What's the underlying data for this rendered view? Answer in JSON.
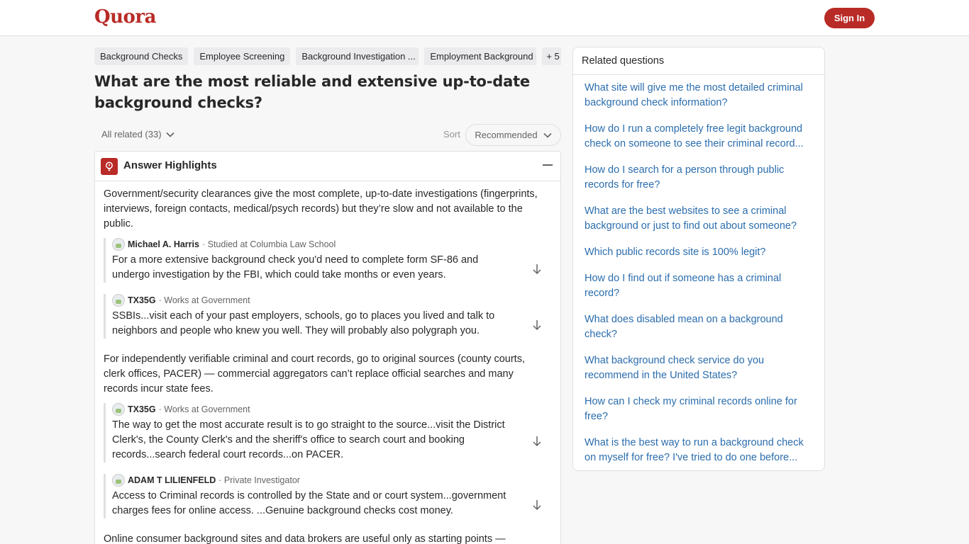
{
  "header": {
    "logo": "Quora",
    "signin_label": "Sign In"
  },
  "topics": [
    "Background Checks",
    "Employee Screening",
    "Background Investigation ...",
    "Employment Background C",
    "+ 5"
  ],
  "question": {
    "title": "What are the most reliable and extensive up-to-date background checks?"
  },
  "filters": {
    "all_related": "All related (33)",
    "sort_label": "Sort",
    "sort_value": "Recommended"
  },
  "highlights": {
    "title": "Answer Highlights",
    "summary1": "Government/security clearances give the most complete, up-to-date investigations (fingerprints, interviews, foreign contacts, medical/psych records) but they’re slow and not available to the public.",
    "quotes1": [
      {
        "author": "Michael A. Harris",
        "credential": "· Studied at Columbia Law School",
        "text": "For a more extensive background check you'd need to complete form SF-86 and undergo investigation by the FBI, which could take months or even years."
      },
      {
        "author": "TX35G",
        "credential": "· Works at Government",
        "text": "SSBIs...visit each of your past employers, schools, go to places you lived and talk to neighbors and people who knew you well. They will probably also polygraph you."
      }
    ],
    "summary2": "For independently verifiable criminal and court records, go to original sources (county courts, clerk offices, PACER) — commercial aggregators can’t replace official searches and many records incur state fees.",
    "quotes2": [
      {
        "author": "TX35G",
        "credential": "· Works at Government",
        "text": "The way to get the most accurate result is to go straight to the source...visit the District Clerk's, the County Clerk's and the sheriff's office to search court and booking records...search federal court records...on PACER."
      },
      {
        "author": "ADAM T LILIENFELD",
        "credential": "· Private Investigator",
        "text": "Access to Criminal records is controlled by the State and or court system...government charges fees for online access. ...Genuine background checks cost money."
      }
    ],
    "summary3": "Online consumer background sites and data brokers are useful only as starting points —"
  },
  "sidebar": {
    "title": "Related questions",
    "questions": [
      "What site will give me the most detailed criminal background check information?",
      "How do I run a completely free legit background check on someone to see their criminal record...",
      "How do I search for a person through public records for free?",
      "What are the best websites to see a criminal background or just to find out about someone?",
      "Which public records site is 100% legit?",
      "How do I find out if someone has a criminal record?",
      "What does disabled mean on a background check?",
      "What background check service do you recommend in the United States?",
      "How can I check my criminal records online for free?",
      "What is the best way to run a background check on myself for free? I've tried to do one before..."
    ]
  },
  "colors": {
    "brand": "#b92b27",
    "link": "#2b6dad"
  }
}
